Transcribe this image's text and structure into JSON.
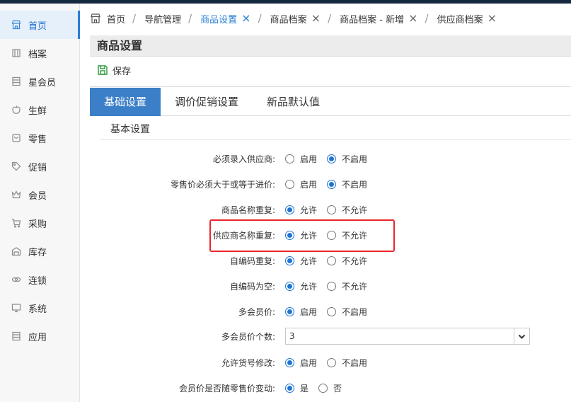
{
  "sidebar": {
    "items": [
      {
        "label": "首页",
        "icon": "store-icon"
      },
      {
        "label": "档案",
        "icon": "archive-icon"
      },
      {
        "label": "星会员",
        "icon": "shelf-icon"
      },
      {
        "label": "生鲜",
        "icon": "apple-icon"
      },
      {
        "label": "零售",
        "icon": "bag-icon"
      },
      {
        "label": "促销",
        "icon": "tag-icon"
      },
      {
        "label": "会员",
        "icon": "crown-icon"
      },
      {
        "label": "采购",
        "icon": "cart-icon"
      },
      {
        "label": "库存",
        "icon": "warehouse-icon"
      },
      {
        "label": "连锁",
        "icon": "link-icon"
      },
      {
        "label": "系统",
        "icon": "monitor-icon"
      },
      {
        "label": "应用",
        "icon": "apps-icon"
      }
    ],
    "active_index": 0
  },
  "tabs": {
    "home": "首页",
    "items": [
      {
        "label": "导航管理",
        "closable": false
      },
      {
        "label": "商品设置",
        "closable": true,
        "active": true
      },
      {
        "label": "商品档案",
        "closable": true
      },
      {
        "label": "商品档案 - 新增",
        "closable": true
      },
      {
        "label": "供应商档案",
        "closable": true
      }
    ],
    "separator": "/",
    "close_glyph": "×"
  },
  "page": {
    "title": "商品设置",
    "save_label": "保存"
  },
  "settings_tabs": [
    "基础设置",
    "调价促销设置",
    "新品默认值"
  ],
  "section": "基本设置",
  "form": {
    "rows": [
      {
        "label": "必须录入供应商:",
        "options": [
          "启用",
          "不启用"
        ],
        "selected": 1
      },
      {
        "label": "零售价必须大于或等于进价:",
        "options": [
          "启用",
          "不启用"
        ],
        "selected": 1
      },
      {
        "label": "商品名称重复:",
        "options": [
          "允许",
          "不允许"
        ],
        "selected": 0
      },
      {
        "label": "供应商名称重复:",
        "options": [
          "允许",
          "不允许"
        ],
        "selected": 0
      },
      {
        "label": "自编码重复:",
        "options": [
          "允许",
          "不允许"
        ],
        "selected": 0
      },
      {
        "label": "自编码为空:",
        "options": [
          "允许",
          "不允许"
        ],
        "selected": 0
      },
      {
        "label": "多会员价:",
        "options": [
          "启用",
          "不启用"
        ],
        "selected": 0
      },
      {
        "label": "多会员价个数:",
        "select_value": "3"
      },
      {
        "label": "允许货号修改:",
        "options": [
          "启用",
          "不启用"
        ],
        "selected": 0
      },
      {
        "label": "会员价是否随零售价变动:",
        "options": [
          "是",
          "否"
        ],
        "selected": 0
      }
    ]
  },
  "colors": {
    "accent": "#2a7fd4",
    "tab_active_bg": "#3b7fc9",
    "highlight": "#e8262b",
    "save_icon": "#2d9a3a"
  }
}
